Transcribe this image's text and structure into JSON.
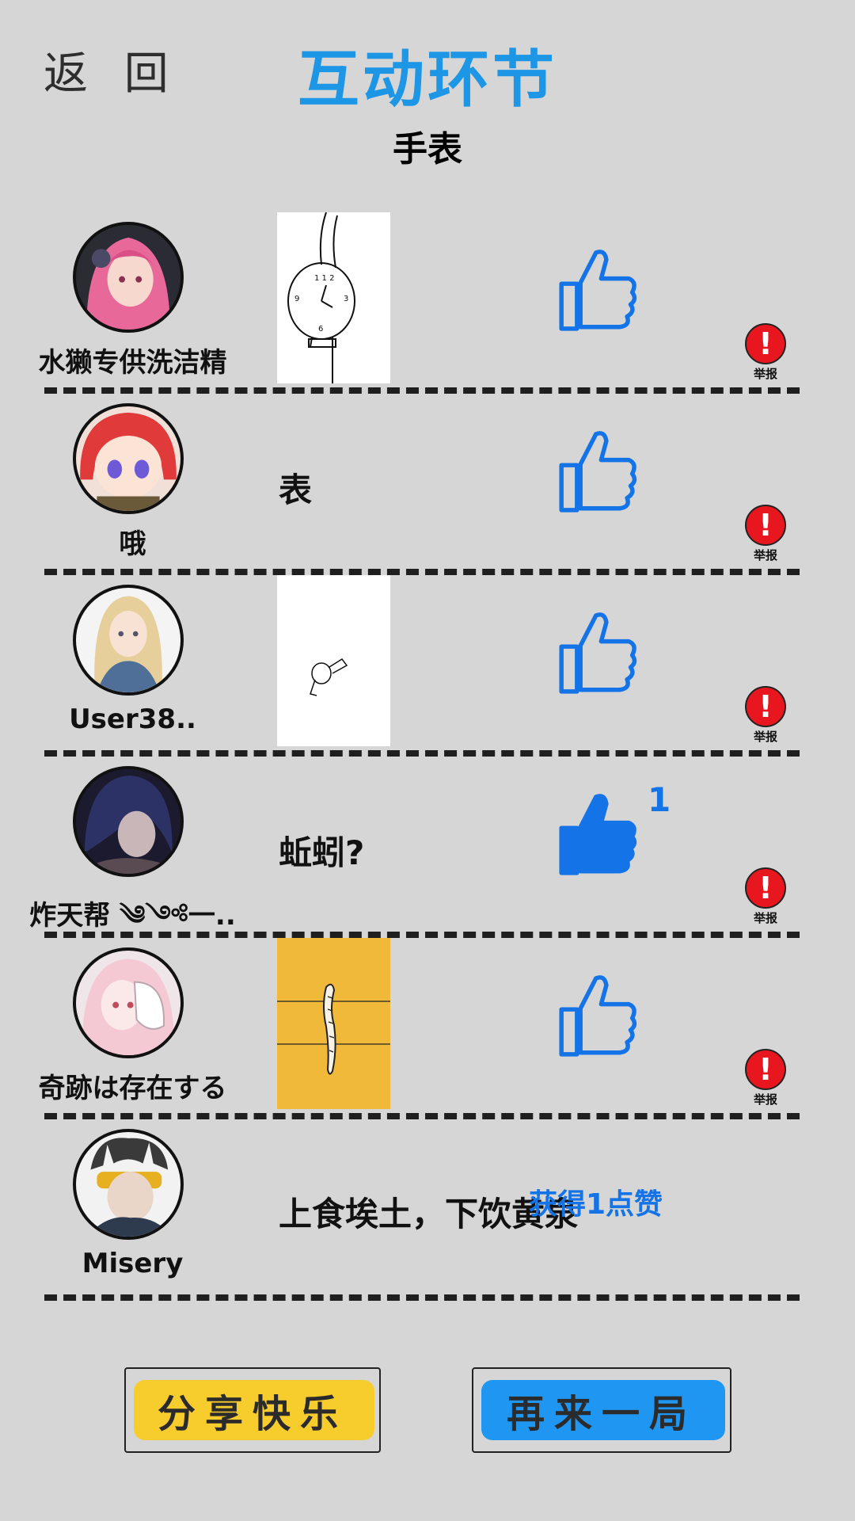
{
  "header": {
    "back_label": "返 回",
    "title": "互动环节",
    "word": "手表"
  },
  "icons": {
    "like_outline": "thumbs-up-outline-icon",
    "like_filled": "thumbs-up-filled-icon",
    "report": "report-alert-icon",
    "accent_blue": "#1473e6",
    "report_red": "#e8161f"
  },
  "rows": [
    {
      "name": "水獭专供洗洁精",
      "answer_type": "drawing",
      "drawing": "watch sketch",
      "liked": false,
      "report_label": "举报"
    },
    {
      "name": "哦",
      "answer_type": "text",
      "answer": "表",
      "liked": false,
      "report_label": "举报"
    },
    {
      "name": "User38..",
      "answer_type": "drawing",
      "drawing": "small watch sketch",
      "liked": false,
      "report_label": "举报"
    },
    {
      "name": "炸天帮 ༄༺一..",
      "answer_type": "text",
      "answer": "蚯蚓?",
      "liked": true,
      "like_count": "1",
      "report_label": "举报"
    },
    {
      "name": "奇跡は存在する",
      "answer_type": "drawing",
      "drawing": "worm on yellow paper",
      "card_color": "#f0b93a",
      "liked": false,
      "report_label": "举报"
    },
    {
      "name": "Misery",
      "answer_type": "text",
      "answer": "上食埃土，下饮黄泉",
      "earned": "获得1点赞"
    }
  ],
  "buttons": {
    "share_label": "分享快乐",
    "share_color": "#f7cc2d",
    "again_label": "再来一局",
    "again_color": "#1f97f2"
  }
}
